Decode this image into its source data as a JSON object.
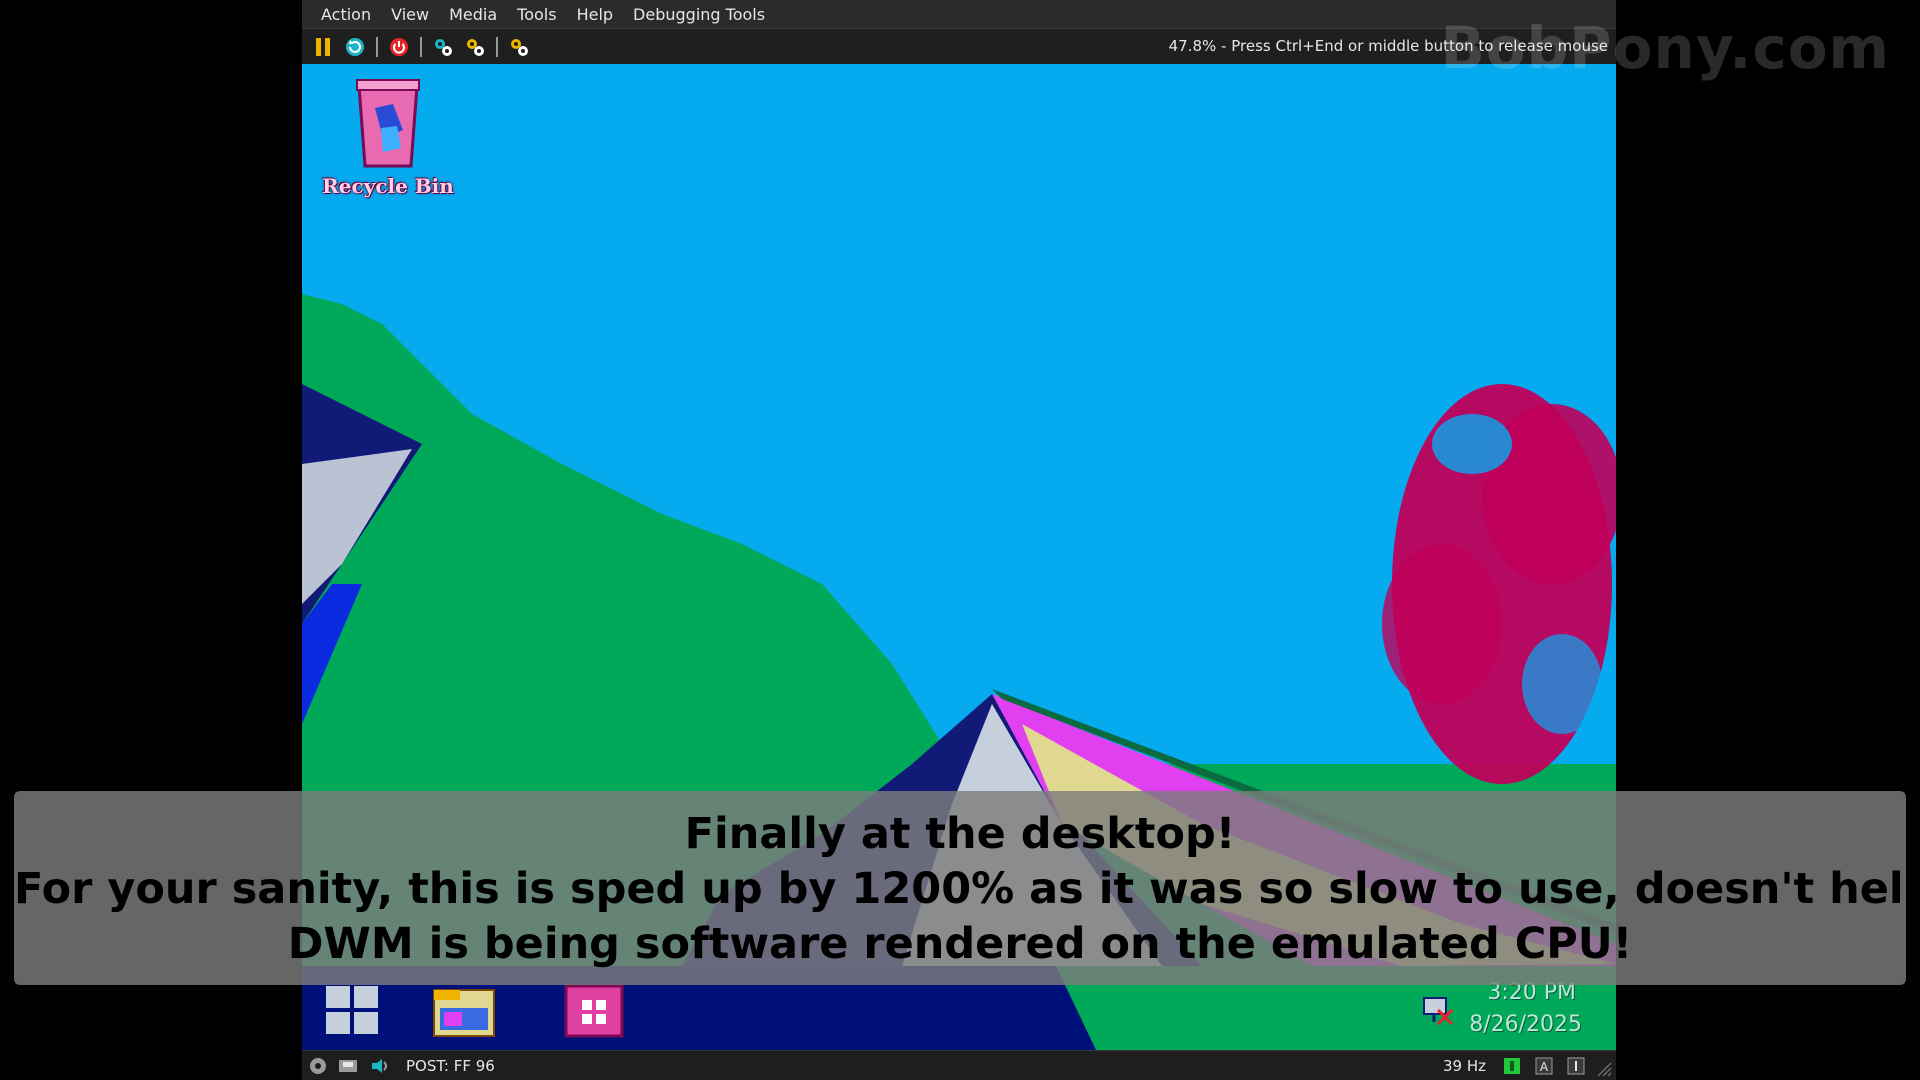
{
  "menubar": {
    "items": [
      "Action",
      "View",
      "Media",
      "Tools",
      "Help",
      "Debugging Tools"
    ]
  },
  "toolbar": {
    "buttons": [
      {
        "icon": "pause-icon",
        "color": "#f0b400"
      },
      {
        "icon": "reset-icon",
        "color": "#1fb5c9"
      },
      {
        "icon": "power-icon",
        "color": "#e8232a"
      },
      {
        "icon": "settings-icon",
        "color": "#1fb5c9"
      },
      {
        "icon": "hardware-settings-icon",
        "color": "#f0b400"
      },
      {
        "icon": "cad-icon",
        "color": "#f0b400"
      }
    ],
    "status_message": "47.8% - Press Ctrl+End or middle button to release mouse"
  },
  "desktop": {
    "icons": [
      {
        "label": "Recycle Bin",
        "icon": "recycle-bin-icon"
      }
    ]
  },
  "taskbar": {
    "apps": [
      {
        "icon": "start-button-icon"
      },
      {
        "icon": "file-explorer-icon"
      },
      {
        "icon": "store-icon"
      }
    ],
    "tray_icon": "network-icon",
    "clock_time": "3:20 PM",
    "clock_date": "8/26/2025"
  },
  "statusbar": {
    "post_code": "POST: FF 96",
    "refresh_rate": "39 Hz",
    "icons": [
      "cdrom-icon",
      "floppy-icon",
      "sound-icon",
      "hdd-activity-icon",
      "keyboard-layout-icon",
      "mouse-capture-icon"
    ]
  },
  "watermark": "BobPony.com",
  "caption": {
    "line1": "Finally at the desktop!",
    "line2": "For your sanity, this is sped up by 1200% as it was so slow to use, doesn't help that",
    "line3": "DWM is being software rendered on the emulated CPU!"
  },
  "colors": {
    "wallpaper_sky": "#05aaef",
    "wallpaper_green": "#00a85a",
    "wallpaper_magenta": "#c0005a",
    "taskbar": "#00107a"
  }
}
